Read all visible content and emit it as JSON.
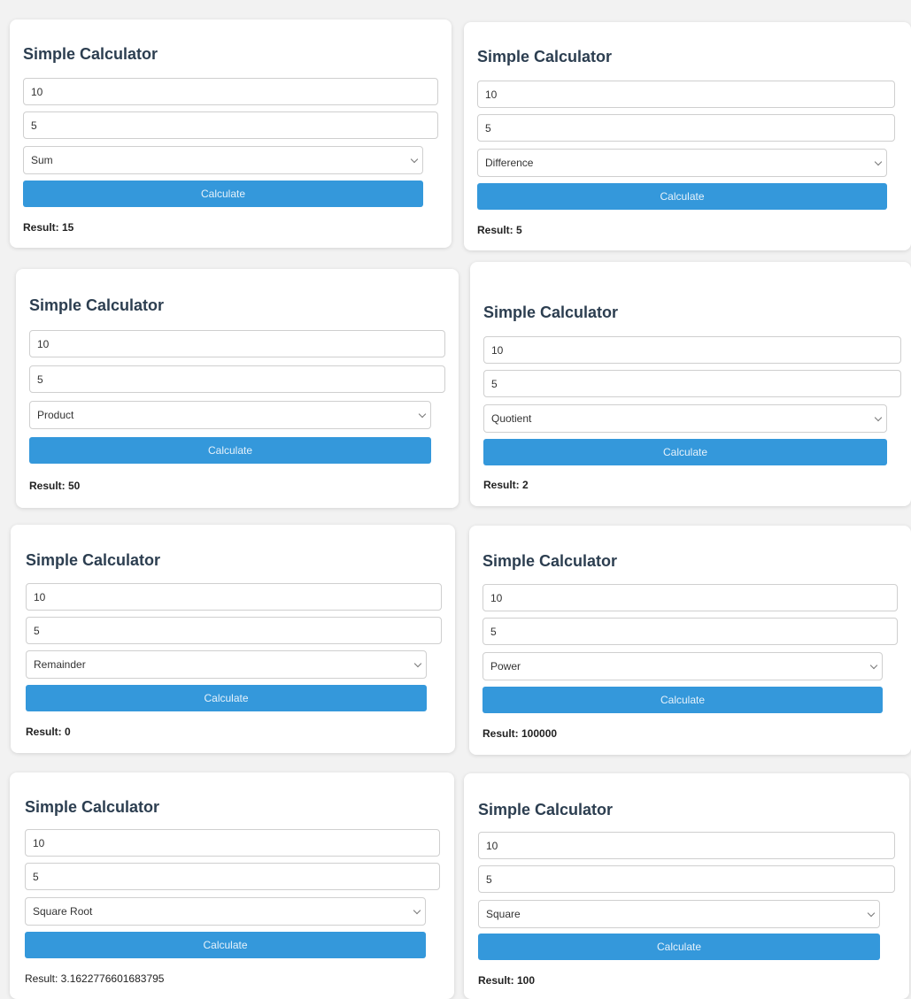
{
  "cards": [
    {
      "title": "Simple Calculator",
      "input1": "10",
      "input2": "5",
      "operation": "Sum",
      "button_label": "Calculate",
      "result": "Result: 15"
    },
    {
      "title": "Simple Calculator",
      "input1": "10",
      "input2": "5",
      "operation": "Difference",
      "button_label": "Calculate",
      "result": "Result: 5"
    },
    {
      "title": "Simple Calculator",
      "input1": "10",
      "input2": "5",
      "operation": "Product",
      "button_label": "Calculate",
      "result": "Result: 50"
    },
    {
      "title": "Simple Calculator",
      "input1": "10",
      "input2": "5",
      "operation": "Quotient",
      "button_label": "Calculate",
      "result": "Result: 2"
    },
    {
      "title": "Simple Calculator",
      "input1": "10",
      "input2": "5",
      "operation": "Remainder",
      "button_label": "Calculate",
      "result": "Result: 0"
    },
    {
      "title": "Simple Calculator",
      "input1": "10",
      "input2": "5",
      "operation": "Power",
      "button_label": "Calculate",
      "result": "Result: 100000"
    },
    {
      "title": "Simple Calculator",
      "input1": "10",
      "input2": "5",
      "operation": "Square Root",
      "button_label": "Calculate",
      "result": "Result: 3.1622776601683795"
    },
    {
      "title": "Simple Calculator",
      "input1": "10",
      "input2": "5",
      "operation": "Square",
      "button_label": "Calculate",
      "result": "Result: 100"
    }
  ],
  "colors": {
    "accent": "#3498db",
    "title": "#2c3e50"
  }
}
